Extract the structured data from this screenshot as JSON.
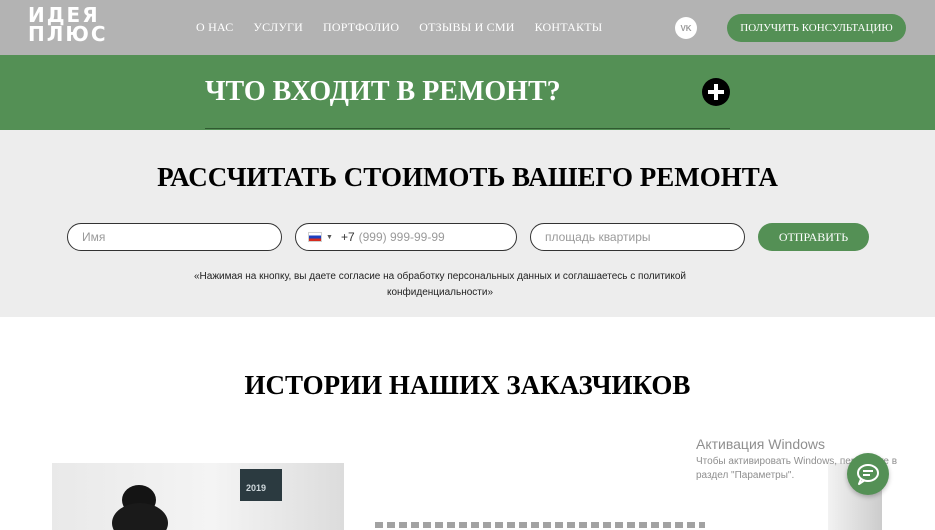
{
  "header": {
    "logo": {
      "line1": "ИДЕЯ",
      "line2": "ПЛЮС"
    },
    "nav": [
      {
        "label": "О НАС"
      },
      {
        "label": "УСЛУГИ"
      },
      {
        "label": "ПОРТФОЛИО"
      },
      {
        "label": "ОТЗЫВЫ И СМИ"
      },
      {
        "label": "КОНТАКТЫ"
      }
    ],
    "vk_label": "VK",
    "consult_label": "ПОЛУЧИТЬ КОНСУЛЬТАЦИЮ"
  },
  "accordion": {
    "title": "ЧТО ВХОДИТ В РЕМОНТ?",
    "icon": "plus-circle-icon"
  },
  "calc": {
    "title": "РАССЧИТАТЬ СТОИМОТЬ ВАШЕГО РЕМОНТА",
    "name_placeholder": "Имя",
    "phone_code": "+7",
    "phone_placeholder": "(999) 999-99-99",
    "area_placeholder": "площадь квартиры",
    "send_label": "ОТПРАВИТЬ",
    "consent_line1": "«Нажимая на кнопку, вы даете согласие на обработку персональных данных и соглашаетесь c политикой",
    "consent_line2": "конфиденциальности»"
  },
  "stories": {
    "title": "ИСТОРИИ НАШИХ ЗАКАЗЧИКОВ",
    "calendar_text": "2019"
  },
  "overlay": {
    "activation_title": "Активация Windows",
    "activation_text": "Чтобы активировать Windows, перейдите в раздел \"Параметры\"."
  },
  "colors": {
    "header_bg": "#b3b3b3",
    "accent_green": "#549055",
    "form_bg": "#ededed"
  }
}
